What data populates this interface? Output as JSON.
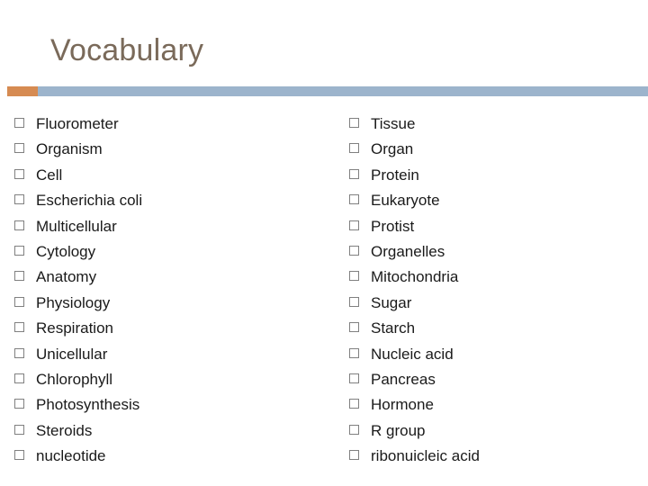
{
  "slide": {
    "title": "Vocabulary",
    "accent_color": "#d68b52",
    "rule_color": "#9cb4cc",
    "title_color": "#7a6a5a",
    "bullet_icon": "empty-square-bullet"
  },
  "columns": {
    "left": [
      "Fluorometer",
      "Organism",
      "Cell",
      "Escherichia coli",
      "Multicellular",
      "Cytology",
      "Anatomy",
      "Physiology",
      "Respiration",
      "Unicellular",
      "Chlorophyll",
      "Photosynthesis",
      "Steroids",
      "nucleotide"
    ],
    "right": [
      "Tissue",
      "Organ",
      "Protein",
      "Eukaryote",
      "Protist",
      "Organelles",
      "Mitochondria",
      "Sugar",
      "Starch",
      "Nucleic acid",
      "Pancreas",
      "Hormone",
      "R group",
      "ribonuicleic acid"
    ]
  }
}
